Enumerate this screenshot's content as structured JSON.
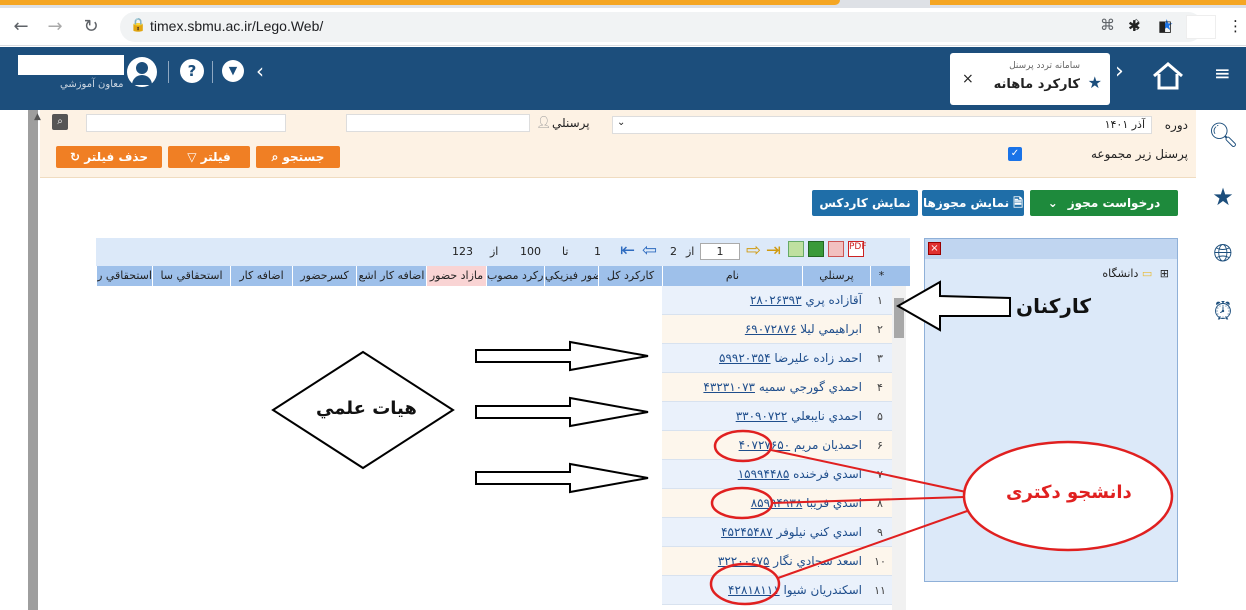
{
  "browser": {
    "url": "timex.sbmu.ac.ir/Lego.Web/"
  },
  "header": {
    "user_subtitle": "معاون آموزشي",
    "help_label": "?",
    "tab_subtitle": "سامانه تردد پرسنل",
    "tab_title": "کارکرد ماهانه",
    "close_label": "×"
  },
  "filter": {
    "period_label": "دوره",
    "period_value": "آذر ۱۴۰۱",
    "personnel_label": "پرسنلي",
    "subordinate_label": "پرسنل زير مجموعه",
    "subordinate_checked": true,
    "search_button": "جستجو",
    "filter_button": "فيلتر",
    "clear_filter_button": "حذف فيلتر"
  },
  "actions": {
    "permit_request": "درخواست مجوز",
    "show_permits": "نمايش مجوزها",
    "show_cardex": "نمايش کاردکس"
  },
  "tree": {
    "root_label": "دانشگاه",
    "expand_label": "⊞"
  },
  "pager": {
    "page_current": "1",
    "page_of_label": "از",
    "page_total": "2",
    "range_from": "1",
    "range_to_label": "تا",
    "range_to": "100",
    "count_of_label": "از",
    "total_records": "123"
  },
  "grid": {
    "columns": [
      "*",
      "پرسنلي",
      "نام",
      "کارکرد کل",
      "حضور فيزيکي",
      "کارکرد مصوب",
      "مازاد حضور",
      "اضافه کار اشع",
      "کسرحضور",
      "اضافه کار",
      "استحقاقي سا",
      "استحقاقي ر"
    ],
    "rows": [
      {
        "num": "۱",
        "code": "۲۸۰۲۶۳۹۳",
        "name": "آقازاده پري"
      },
      {
        "num": "۲",
        "code": "۶۹۰۷۲۸۷۶",
        "name": "ابراهيمي ليلا"
      },
      {
        "num": "۳",
        "code": "۵۹۹۲۰۳۵۴",
        "name": "احمد زاده عليرضا"
      },
      {
        "num": "۴",
        "code": "۴۳۲۳۱۰۷۳",
        "name": "احمدي گورجي سميه"
      },
      {
        "num": "۵",
        "code": "۳۳۰۹۰۷۲۲",
        "name": "احمدي نايبعلي"
      },
      {
        "num": "۶",
        "code": "۴۰۷۲۷۶۵۰",
        "name": "احمديان مريم"
      },
      {
        "num": "۷",
        "code": "۱۵۹۹۴۴۸۵",
        "name": "اسدي فرخنده"
      },
      {
        "num": "۸",
        "code": "۸۵۹۹۴۹۳۸",
        "name": "اسدي فريبا"
      },
      {
        "num": "۹",
        "code": "۴۵۲۴۵۴۸۷",
        "name": "اسدي كني نيلوفر"
      },
      {
        "num": "۱۰",
        "code": "۳۲۲۰۰۶۷۵",
        "name": "اسعد سجادي نگار"
      },
      {
        "num": "۱۱",
        "code": "۴۲۸۱۸۱۱۱",
        "name": "اسكندريان شيوا"
      }
    ]
  },
  "annotations": {
    "staff": "کارکنان",
    "faculty": "هيات علمي",
    "phd_student": "دانشجو دکتری"
  },
  "colors": {
    "header_bg": "#1c4e7c",
    "accent_orange": "#f07f24",
    "green": "#1e8a3c",
    "blue": "#1f6ea8",
    "annotation_red": "#e02020"
  }
}
